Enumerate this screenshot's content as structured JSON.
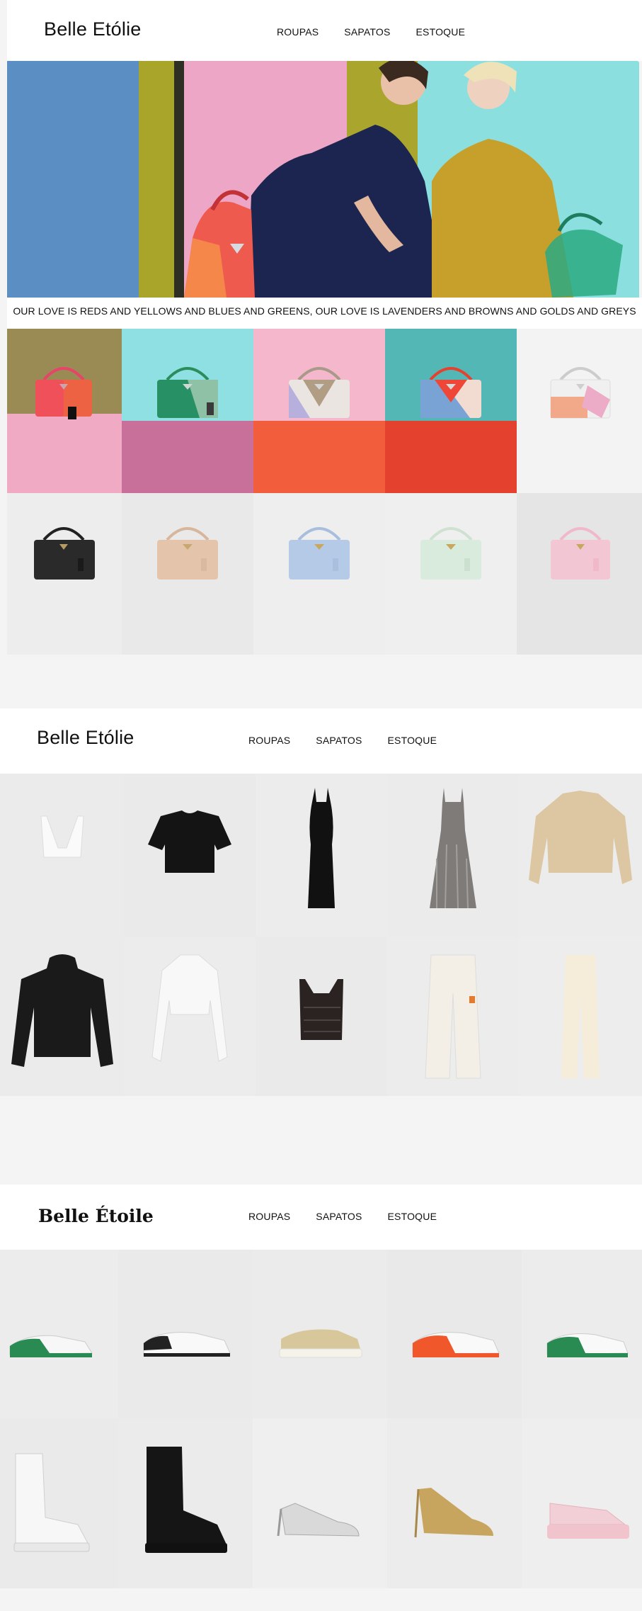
{
  "sections": [
    {
      "brand": "Belle Etólie",
      "nav": [
        "ROUPAS",
        "SAPATOS",
        "ESTOQUE"
      ]
    },
    {
      "brand": "Belle Etólie",
      "nav": [
        "ROUPAS",
        "SAPATOS",
        "ESTOQUE"
      ]
    },
    {
      "brand": "Belle Étoile",
      "nav": [
        "ROUPAS",
        "SAPATOS",
        "ESTOQUE"
      ]
    }
  ],
  "hero": {
    "tagline": "OUR LOVE IS REDS AND YELLOWS AND BLUES AND GREENS, OUR LOVE IS LAVENDERS AND BROWNS AND GOLDS AND GREYS"
  },
  "colors": {
    "page_bg": "#f4f4f4",
    "header_bg": "#ffffff",
    "text": "#111111"
  },
  "bags": {
    "row1": [
      "red-orange-bag",
      "green-bag",
      "beige-lilac-bag",
      "red-blue-bag",
      "peach-pink-bag"
    ],
    "row2": [
      "black-bag",
      "beige-bag",
      "light-blue-bag",
      "mint-bag",
      "pink-bag"
    ]
  },
  "clothes": {
    "row1": [
      "white-bralette",
      "black-crop-tee",
      "black-maxi-dress",
      "grey-pleated-dress",
      "beige-cropped-jacket"
    ],
    "row2": [
      "black-hooded-jacket",
      "white-cropped-shirt",
      "black-crochet-top",
      "white-wide-pants",
      "cream-trousers"
    ]
  },
  "shoes": {
    "row1": [
      "green-white-sneaker",
      "white-sneaker",
      "gold-platform-sneaker",
      "orange-white-sneaker",
      "green-white-sneaker-2"
    ],
    "row2": [
      "white-combat-boots",
      "black-combat-boots",
      "silver-slingback-pump",
      "gold-slingback-pump",
      "pink-platform-sandal"
    ]
  }
}
